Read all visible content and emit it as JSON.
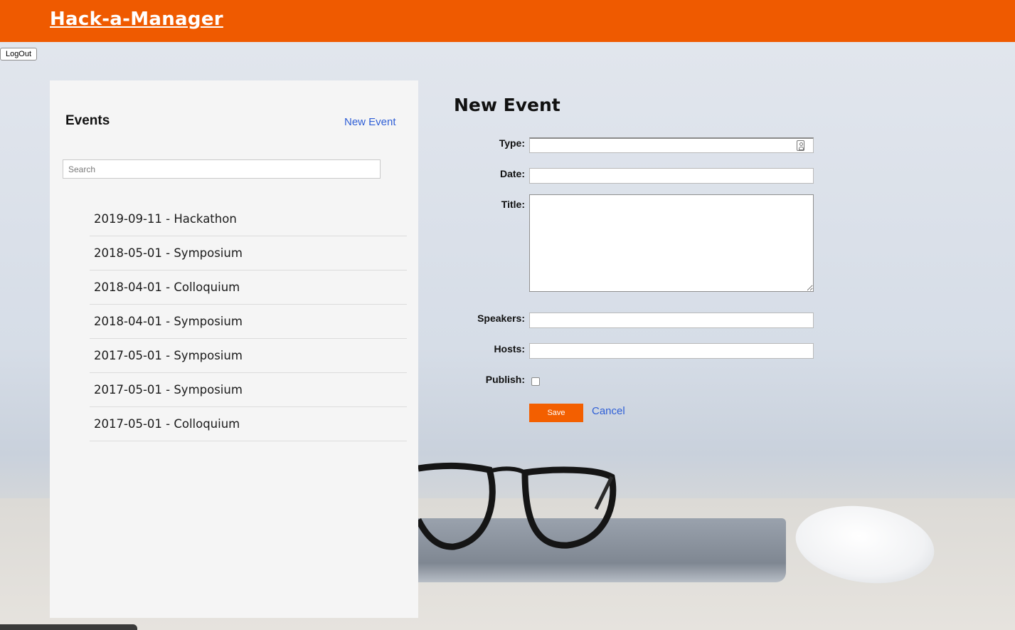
{
  "header": {
    "brand": "Hack-a-Manager"
  },
  "auth": {
    "logout_label": "LogOut"
  },
  "sidebar": {
    "title": "Events",
    "new_event_label": "New Event",
    "search": {
      "placeholder": "Search",
      "value": ""
    },
    "events": [
      "2019-09-11 - Hackathon",
      "2018-05-01 - Symposium",
      "2018-04-01 - Colloquium",
      "2018-04-01 - Symposium",
      "2017-05-01 - Symposium",
      "2017-05-01 - Symposium",
      "2017-05-01 - Colloquium"
    ]
  },
  "form": {
    "title": "New Event",
    "labels": {
      "type": "Type:",
      "date": "Date:",
      "title": "Title:",
      "speakers": "Speakers:",
      "hosts": "Hosts:",
      "publish": "Publish:"
    },
    "values": {
      "type": "",
      "date": "",
      "title": "",
      "speakers": "",
      "hosts": "",
      "publish": false
    },
    "save_label": "Save",
    "cancel_label": "Cancel"
  },
  "colors": {
    "header": "#ef5a00",
    "save_button": "#f35f00",
    "link": "#2f5fd6",
    "sidebar_bg": "#f5f5f5"
  },
  "icons": {
    "type_field": "contact-card-icon"
  }
}
